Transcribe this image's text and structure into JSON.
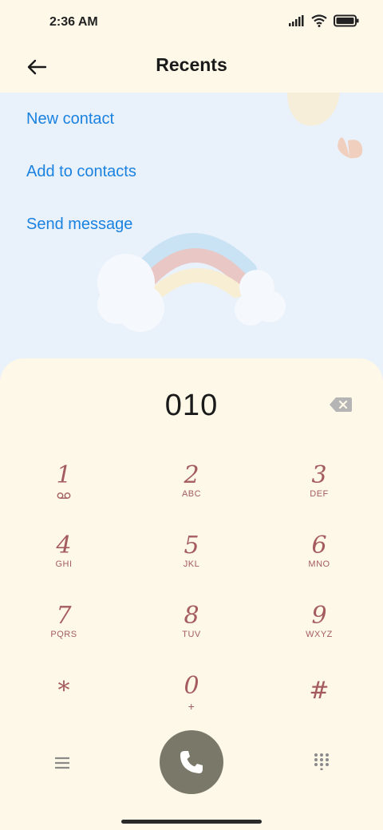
{
  "status_bar": {
    "time": "2:36 AM",
    "icons": [
      "signal-icon",
      "wifi-icon",
      "battery-icon"
    ]
  },
  "header": {
    "title": "Recents",
    "back_icon": "arrow-left-icon"
  },
  "actions": {
    "new_contact": "New contact",
    "add_to_contacts": "Add to contacts",
    "send_message": "Send message"
  },
  "dialer": {
    "number": "010",
    "backspace_icon": "backspace-icon",
    "keys": [
      {
        "digit": "1",
        "letters": "voicemail"
      },
      {
        "digit": "2",
        "letters": "ABC"
      },
      {
        "digit": "3",
        "letters": "DEF"
      },
      {
        "digit": "4",
        "letters": "GHI"
      },
      {
        "digit": "5",
        "letters": "JKL"
      },
      {
        "digit": "6",
        "letters": "MNO"
      },
      {
        "digit": "7",
        "letters": "PQRS"
      },
      {
        "digit": "8",
        "letters": "TUV"
      },
      {
        "digit": "9",
        "letters": "WXYZ"
      },
      {
        "digit": "*",
        "letters": ""
      },
      {
        "digit": "0",
        "letters": "+"
      },
      {
        "digit": "#",
        "letters": ""
      }
    ],
    "menu_icon": "menu-icon",
    "call_icon": "phone-icon",
    "keypad_icon": "keypad-icon"
  },
  "colors": {
    "background": "#fdf8e8",
    "panel": "#e9f1fb",
    "link": "#1a82e0",
    "key_text": "#a55c60",
    "call_button": "#7a7868"
  }
}
